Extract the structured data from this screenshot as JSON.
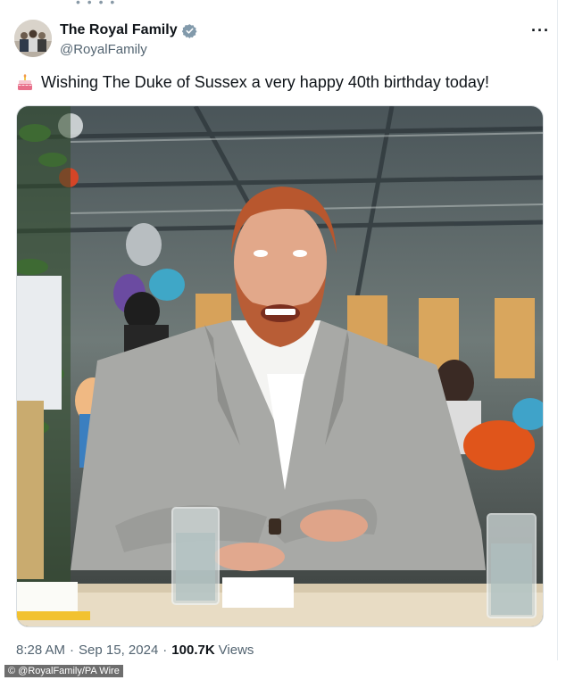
{
  "tweet": {
    "author": {
      "display_name": "The Royal Family",
      "handle": "@RoyalFamily",
      "verified_color": "#829aab"
    },
    "more_icon": "ellipsis-icon",
    "more_label": "···",
    "emoji": "birthday-cake",
    "text": "Wishing The Duke of Sussex a very happy 40th birthday today!",
    "time": "8:28 AM",
    "date": "Sep 15, 2024",
    "separator": "·",
    "views_count": "100.7K",
    "views_label": "Views"
  },
  "credit": "© @RoyalFamily/PA Wire"
}
